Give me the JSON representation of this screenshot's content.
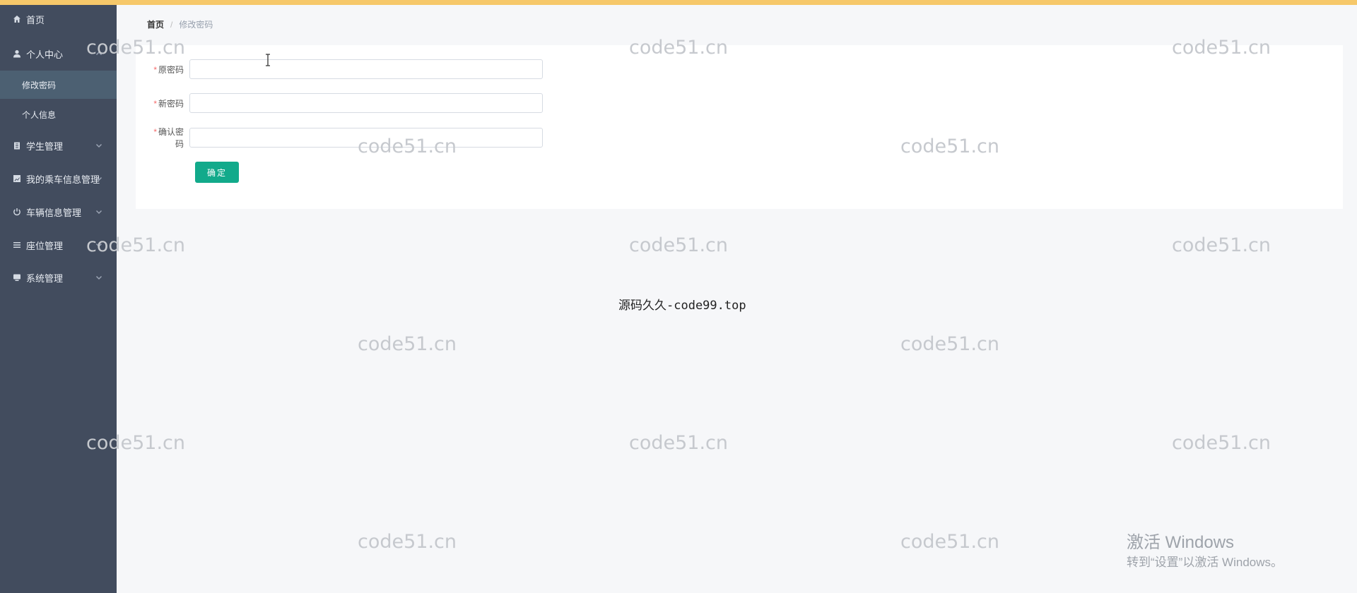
{
  "sidebar": {
    "items": [
      {
        "label": "首页",
        "icon": "home-icon"
      },
      {
        "label": "个人中心",
        "icon": "user-icon"
      },
      {
        "label": "学生管理",
        "icon": "clipboard-icon"
      },
      {
        "label": "我的乘车信息管理",
        "icon": "chart-icon"
      },
      {
        "label": "车辆信息管理",
        "icon": "power-icon"
      },
      {
        "label": "座位管理",
        "icon": "list-icon"
      },
      {
        "label": "系统管理",
        "icon": "monitor-icon"
      }
    ],
    "sub_items": [
      {
        "label": "修改密码",
        "active": true
      },
      {
        "label": "个人信息",
        "active": false
      }
    ],
    "active_color": "#4c6072",
    "background_color": "#424c5e"
  },
  "breadcrumb": {
    "home": "首页",
    "separator": "/",
    "current": "修改密码"
  },
  "form": {
    "required_mark": "*",
    "fields": [
      {
        "label": "原密码",
        "value": "",
        "placeholder": ""
      },
      {
        "label": "新密码",
        "value": "",
        "placeholder": ""
      },
      {
        "label": "确认密码",
        "value": "",
        "placeholder": ""
      }
    ],
    "submit_label": "确定",
    "accent_color": "#12aa8b"
  },
  "source_text": "源码久久-code99.top",
  "watermark_text": "code51.cn",
  "windows_activation": {
    "title": "激活 Windows",
    "subtitle": "转到“设置”以激活 Windows。"
  },
  "colors": {
    "top_bar": "#f6c86a",
    "page_background": "#f6f7f9"
  }
}
